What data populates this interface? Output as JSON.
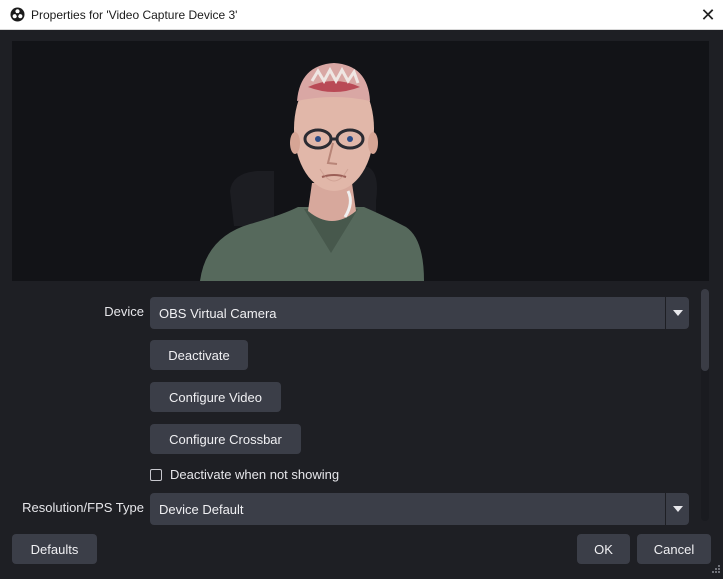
{
  "window": {
    "title": "Properties for 'Video Capture Device 3'",
    "close_glyph": "✕",
    "app_icon": "obs-logo-icon"
  },
  "preview": {
    "content": "camera-feed-person"
  },
  "form": {
    "device_label": "Device",
    "device_value": "OBS Virtual Camera",
    "deactivate_label": "Deactivate",
    "configure_video_label": "Configure Video",
    "configure_crossbar_label": "Configure Crossbar",
    "deactivate_when_not_showing_label": "Deactivate when not showing",
    "deactivate_when_not_showing_checked": false,
    "resolution_fps_type_label": "Resolution/FPS Type",
    "resolution_fps_type_value": "Device Default"
  },
  "footer": {
    "defaults_label": "Defaults",
    "ok_label": "OK",
    "cancel_label": "Cancel"
  },
  "colors": {
    "background": "#1e1f24",
    "control": "#3b3e48",
    "preview_bg": "#121317",
    "titlebar": "#ffffff"
  }
}
